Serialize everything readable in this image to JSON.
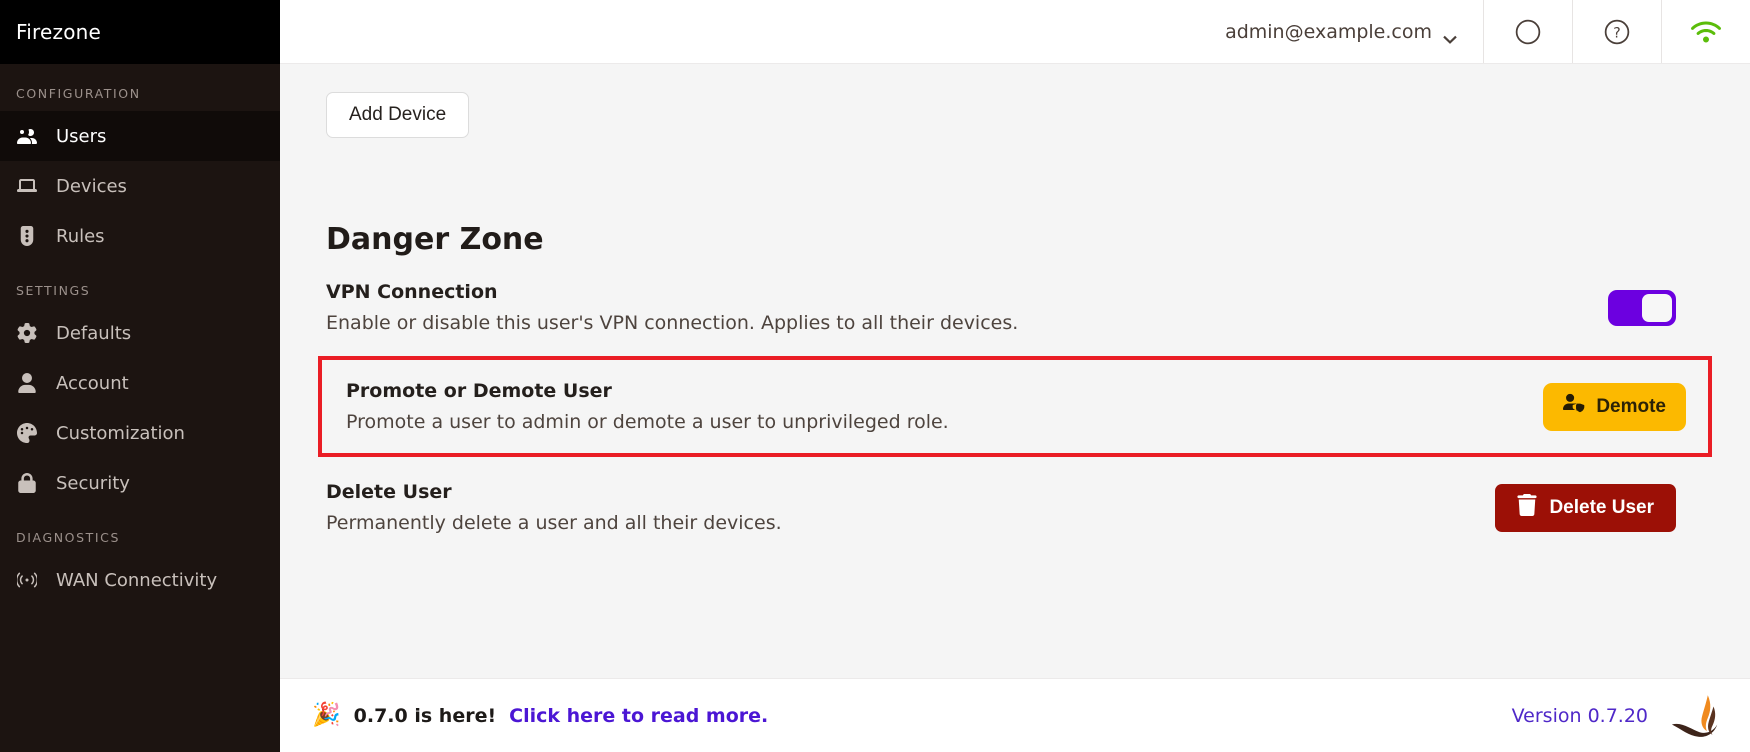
{
  "app": {
    "brand": "Firezone"
  },
  "sidebar": {
    "sections": [
      {
        "title": "CONFIGURATION",
        "items": [
          {
            "label": "Users",
            "icon": "users-icon",
            "active": true
          },
          {
            "label": "Devices",
            "icon": "laptop-icon",
            "active": false
          },
          {
            "label": "Rules",
            "icon": "traffic-light-icon",
            "active": false
          }
        ]
      },
      {
        "title": "SETTINGS",
        "items": [
          {
            "label": "Defaults",
            "icon": "gear-icon",
            "active": false
          },
          {
            "label": "Account",
            "icon": "person-icon",
            "active": false
          },
          {
            "label": "Customization",
            "icon": "palette-icon",
            "active": false
          },
          {
            "label": "Security",
            "icon": "lock-icon",
            "active": false
          }
        ]
      },
      {
        "title": "DIAGNOSTICS",
        "items": [
          {
            "label": "WAN Connectivity",
            "icon": "broadcast-icon",
            "active": false
          }
        ]
      }
    ]
  },
  "topbar": {
    "user_email": "admin@example.com",
    "chevron": "chevron-down-icon",
    "buttons": [
      {
        "name": "circle-icon",
        "label": ""
      },
      {
        "name": "help-circle-icon",
        "label": ""
      },
      {
        "name": "wifi-icon",
        "label": ""
      }
    ],
    "wifi_color": "#5bbd0a"
  },
  "main": {
    "add_device_label": "Add Device",
    "danger_zone_title": "Danger Zone",
    "rows": [
      {
        "title": "VPN Connection",
        "desc": "Enable or disable this user's VPN connection. Applies to all their devices.",
        "control": "toggle",
        "toggle_on": true
      },
      {
        "title": "Promote or Demote User",
        "desc": "Promote a user to admin or demote a user to unprivileged role.",
        "control": "demote-button",
        "button_label": "Demote",
        "highlighted": true
      },
      {
        "title": "Delete User",
        "desc": "Permanently delete a user and all their devices.",
        "control": "delete-button",
        "button_label": "Delete User"
      }
    ]
  },
  "footer": {
    "emoji": "🎉",
    "announce_bold": "0.7.0 is here!",
    "announce_link": "Click here to read more.",
    "version": "Version 0.7.20"
  },
  "colors": {
    "sidebar_bg": "#1c1411",
    "brand_bg": "#000000",
    "content_bg": "#f5f5f5",
    "toggle_on": "#6c00e0",
    "highlight_border": "#ea1d25",
    "amber": "#fcb900",
    "danger": "#9c1006",
    "link_purple": "#4b16d4",
    "wifi_green": "#5bbd0a"
  }
}
